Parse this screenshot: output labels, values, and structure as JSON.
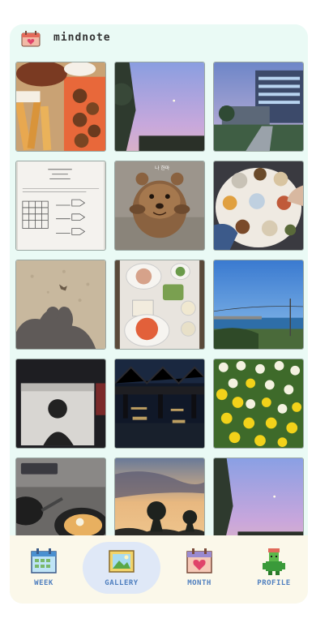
{
  "app": {
    "title": "mindnote",
    "icon": "calendar-heart-icon"
  },
  "gallery": {
    "photos": [
      {
        "subject": "fried food platter"
      },
      {
        "subject": "purple dusk sky"
      },
      {
        "subject": "campus building at dusk"
      },
      {
        "subject": "worksheet with circuit diagrams"
      },
      {
        "subject": "quokka photo"
      },
      {
        "subject": "dinner table with dishes"
      },
      {
        "subject": "shadow on sand"
      },
      {
        "subject": "tray of side dishes"
      },
      {
        "subject": "seaside with lamp post"
      },
      {
        "subject": "concert screen"
      },
      {
        "subject": "bridge at night"
      },
      {
        "subject": "yellow and white tulips"
      },
      {
        "subject": "grill and pans"
      },
      {
        "subject": "sunset with pine trees"
      },
      {
        "subject": "purple sky with moon"
      }
    ]
  },
  "nav": {
    "items": [
      {
        "label": "WEEK",
        "icon": "calendar-grid-icon",
        "active": false
      },
      {
        "label": "GALLERY",
        "icon": "picture-icon",
        "active": true
      },
      {
        "label": "MONTH",
        "icon": "calendar-heart-icon",
        "active": false
      },
      {
        "label": "PROFILE",
        "icon": "person-icon",
        "active": false
      }
    ]
  },
  "colors": {
    "accent": "#4f7fbf",
    "background": "#eafaf5",
    "nav_bg": "#fbf8ea",
    "active_pill": "#dfe8f7"
  }
}
